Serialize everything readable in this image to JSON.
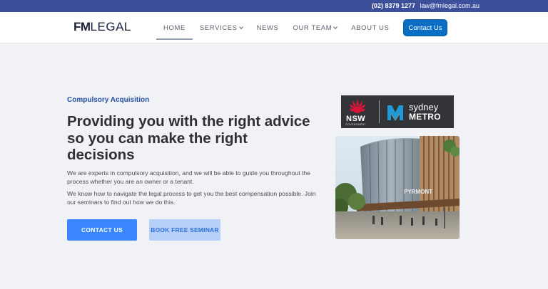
{
  "topbar": {
    "phone": "(02) 8379 1277",
    "email": "law@fmlegal.com.au"
  },
  "nav": {
    "logo": {
      "fm": "FM",
      "legal": "LEGAL"
    },
    "items": [
      {
        "label": "HOME",
        "active": true,
        "dropdown": false
      },
      {
        "label": "SERVICES",
        "active": false,
        "dropdown": true
      },
      {
        "label": "NEWS",
        "active": false,
        "dropdown": false
      },
      {
        "label": "OUR TEAM",
        "active": false,
        "dropdown": true
      },
      {
        "label": "ABOUT US",
        "active": false,
        "dropdown": false
      }
    ],
    "contact_label": "Contact Us"
  },
  "hero": {
    "eyebrow": "Compulsory Acquisition",
    "headline": "Providing you with the right advice so you can make the right decisions",
    "para1": "We are experts in compulsory acquisition, and we will be able to guide you throughout the process whether you are an owner or a tenant.",
    "para2": "We know how to navigate the legal process to get you the best compensation possible. Join our seminars to find out how we do this.",
    "btn_contact": "CONTACT US",
    "btn_seminar": "BOOK FREE SEMINAR"
  },
  "partner_logos": {
    "nsw": "NSW",
    "government": "GOVERNMENT",
    "sydney": "sydney",
    "metro": "METRO"
  },
  "photo": {
    "sign_text": "PYRMONT"
  },
  "colors": {
    "topbar": "#3b4f9a",
    "primary": "#0a6ec4",
    "button_blue": "#3a86ff",
    "button_light": "#b7d0fa",
    "eyebrow": "#2150a9",
    "nsw_red": "#d7153a",
    "metro_teal": "#1f9ad6"
  },
  "icons": [
    "chevron-down-icon",
    "waratah-icon",
    "metro-m-icon"
  ]
}
